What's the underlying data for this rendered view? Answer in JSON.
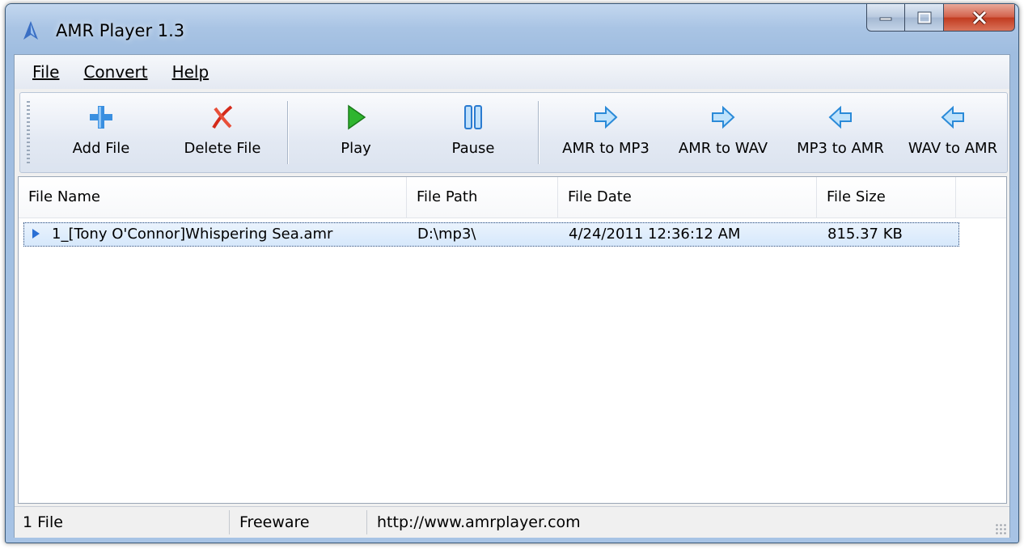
{
  "window": {
    "title": "AMR Player 1.3"
  },
  "menu": [
    {
      "label": "File"
    },
    {
      "label": "Convert"
    },
    {
      "label": "Help"
    }
  ],
  "toolbar": {
    "add": "Add File",
    "delete": "Delete File",
    "play": "Play",
    "pause": "Pause",
    "amr_mp3": "AMR to MP3",
    "amr_wav": "AMR to WAV",
    "mp3_amr": "MP3 to AMR",
    "wav_amr": "WAV to AMR"
  },
  "columns": {
    "name": "File Name",
    "path": "File Path",
    "date": "File Date",
    "size": "File Size"
  },
  "rows": [
    {
      "name": "1_[Tony O'Connor]Whispering Sea.amr",
      "path": "D:\\mp3\\",
      "date": "4/24/2011 12:36:12 AM",
      "size": "815.37 KB"
    }
  ],
  "status": {
    "count": "1 File",
    "license": "Freeware",
    "url": "http://www.amrplayer.com"
  },
  "colors": {
    "titlebar": "#a9c4e4",
    "selection": "#d6e8fb",
    "close_button": "#c13a1f"
  }
}
